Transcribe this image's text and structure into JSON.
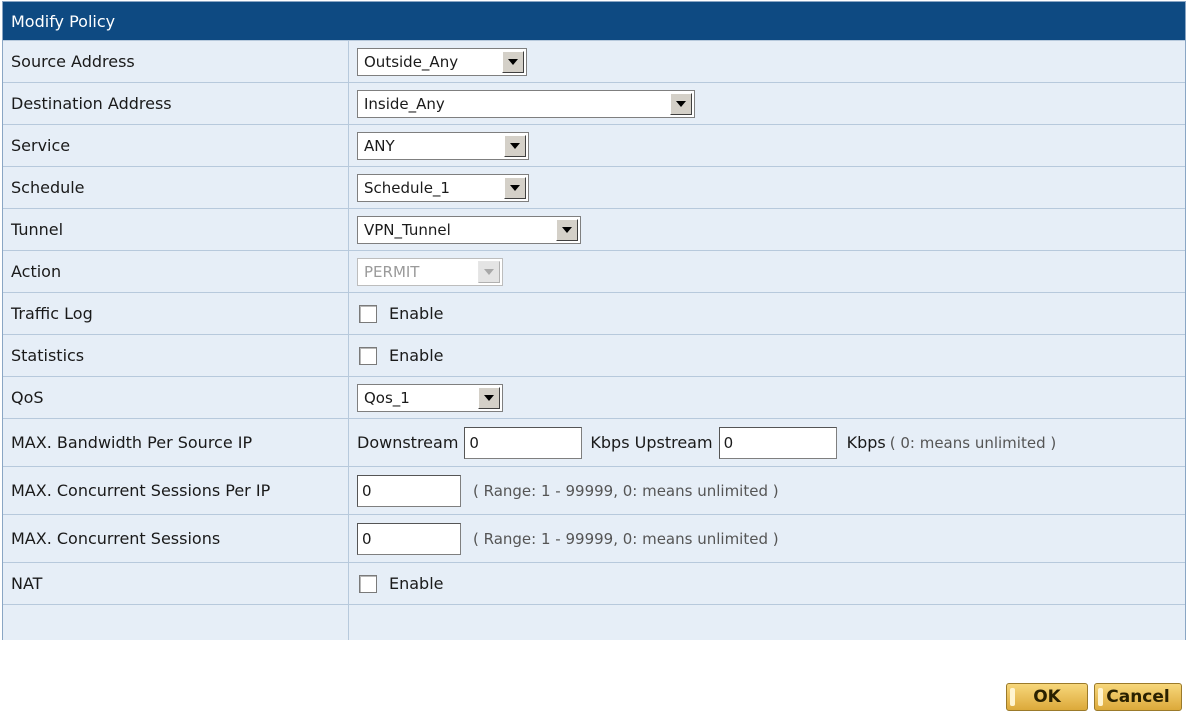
{
  "header": {
    "title": "Modify Policy"
  },
  "rows": {
    "source_address": {
      "label": "Source Address",
      "value": "Outside_Any"
    },
    "destination_address": {
      "label": "Destination Address",
      "value": "Inside_Any"
    },
    "service": {
      "label": "Service",
      "value": "ANY"
    },
    "schedule": {
      "label": "Schedule",
      "value": "Schedule_1"
    },
    "tunnel": {
      "label": "Tunnel",
      "value": "VPN_Tunnel"
    },
    "action": {
      "label": "Action",
      "value": "PERMIT"
    },
    "traffic_log": {
      "label": "Traffic Log",
      "checkbox_label": "Enable"
    },
    "statistics": {
      "label": "Statistics",
      "checkbox_label": "Enable"
    },
    "qos": {
      "label": "QoS",
      "value": "Qos_1"
    },
    "max_bandwidth": {
      "label": "MAX. Bandwidth Per Source IP",
      "downstream_label": "Downstream",
      "downstream_value": "0",
      "kbps_upstream_label": "Kbps Upstream",
      "upstream_value": "0",
      "kbps_label": "Kbps",
      "hint": "( 0: means unlimited )"
    },
    "max_sessions_per_ip": {
      "label": "MAX. Concurrent Sessions Per IP",
      "value": "0",
      "hint": "( Range: 1 - 99999, 0: means unlimited )"
    },
    "max_sessions": {
      "label": "MAX. Concurrent Sessions",
      "value": "0",
      "hint": "( Range: 1 - 99999, 0: means unlimited )"
    },
    "nat": {
      "label": "NAT",
      "checkbox_label": "Enable"
    }
  },
  "buttons": {
    "ok": "OK",
    "cancel": "Cancel"
  }
}
